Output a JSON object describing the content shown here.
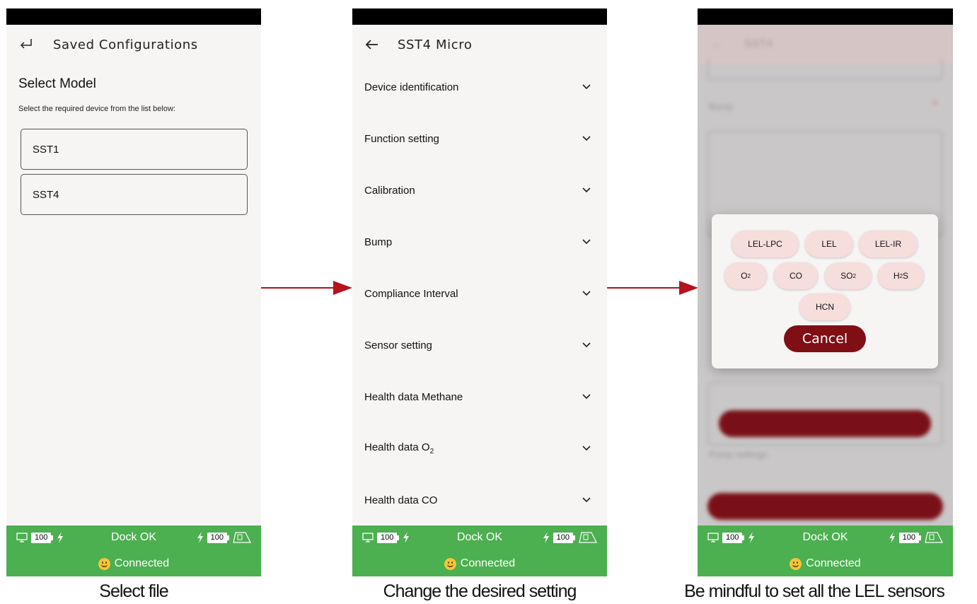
{
  "panel1": {
    "title": "Saved Configurations",
    "heading": "Select Model",
    "subtitle": "Select the required device from the list below:",
    "models": [
      "SST1",
      "SST4"
    ]
  },
  "panel2": {
    "title": "SST4 Micro",
    "sections": [
      "Device identification",
      "Function setting",
      "Calibration",
      "Bump",
      "Compliance Interval",
      "Sensor setting",
      "Health data Methane",
      "Health data O2",
      "Health data CO"
    ]
  },
  "panel3": {
    "sensor_chips": [
      "LEL-LPC",
      "LEL",
      "LEL-IR",
      "O2",
      "CO",
      "SO2",
      "H2S",
      "HCN"
    ],
    "cancel_label": "Cancel"
  },
  "footer": {
    "left_battery": "100",
    "dock_status": "Dock OK",
    "right_battery": "100",
    "connection": "Connected"
  },
  "captions": [
    "Select file",
    "Change the desired setting",
    "Be mindful to set all the LEL sensors"
  ],
  "colors": {
    "footer_green": "#4caf50",
    "arrow_red": "#b3141e",
    "cancel_red": "#7f0e15",
    "chip_pink": "#f6dedd"
  }
}
